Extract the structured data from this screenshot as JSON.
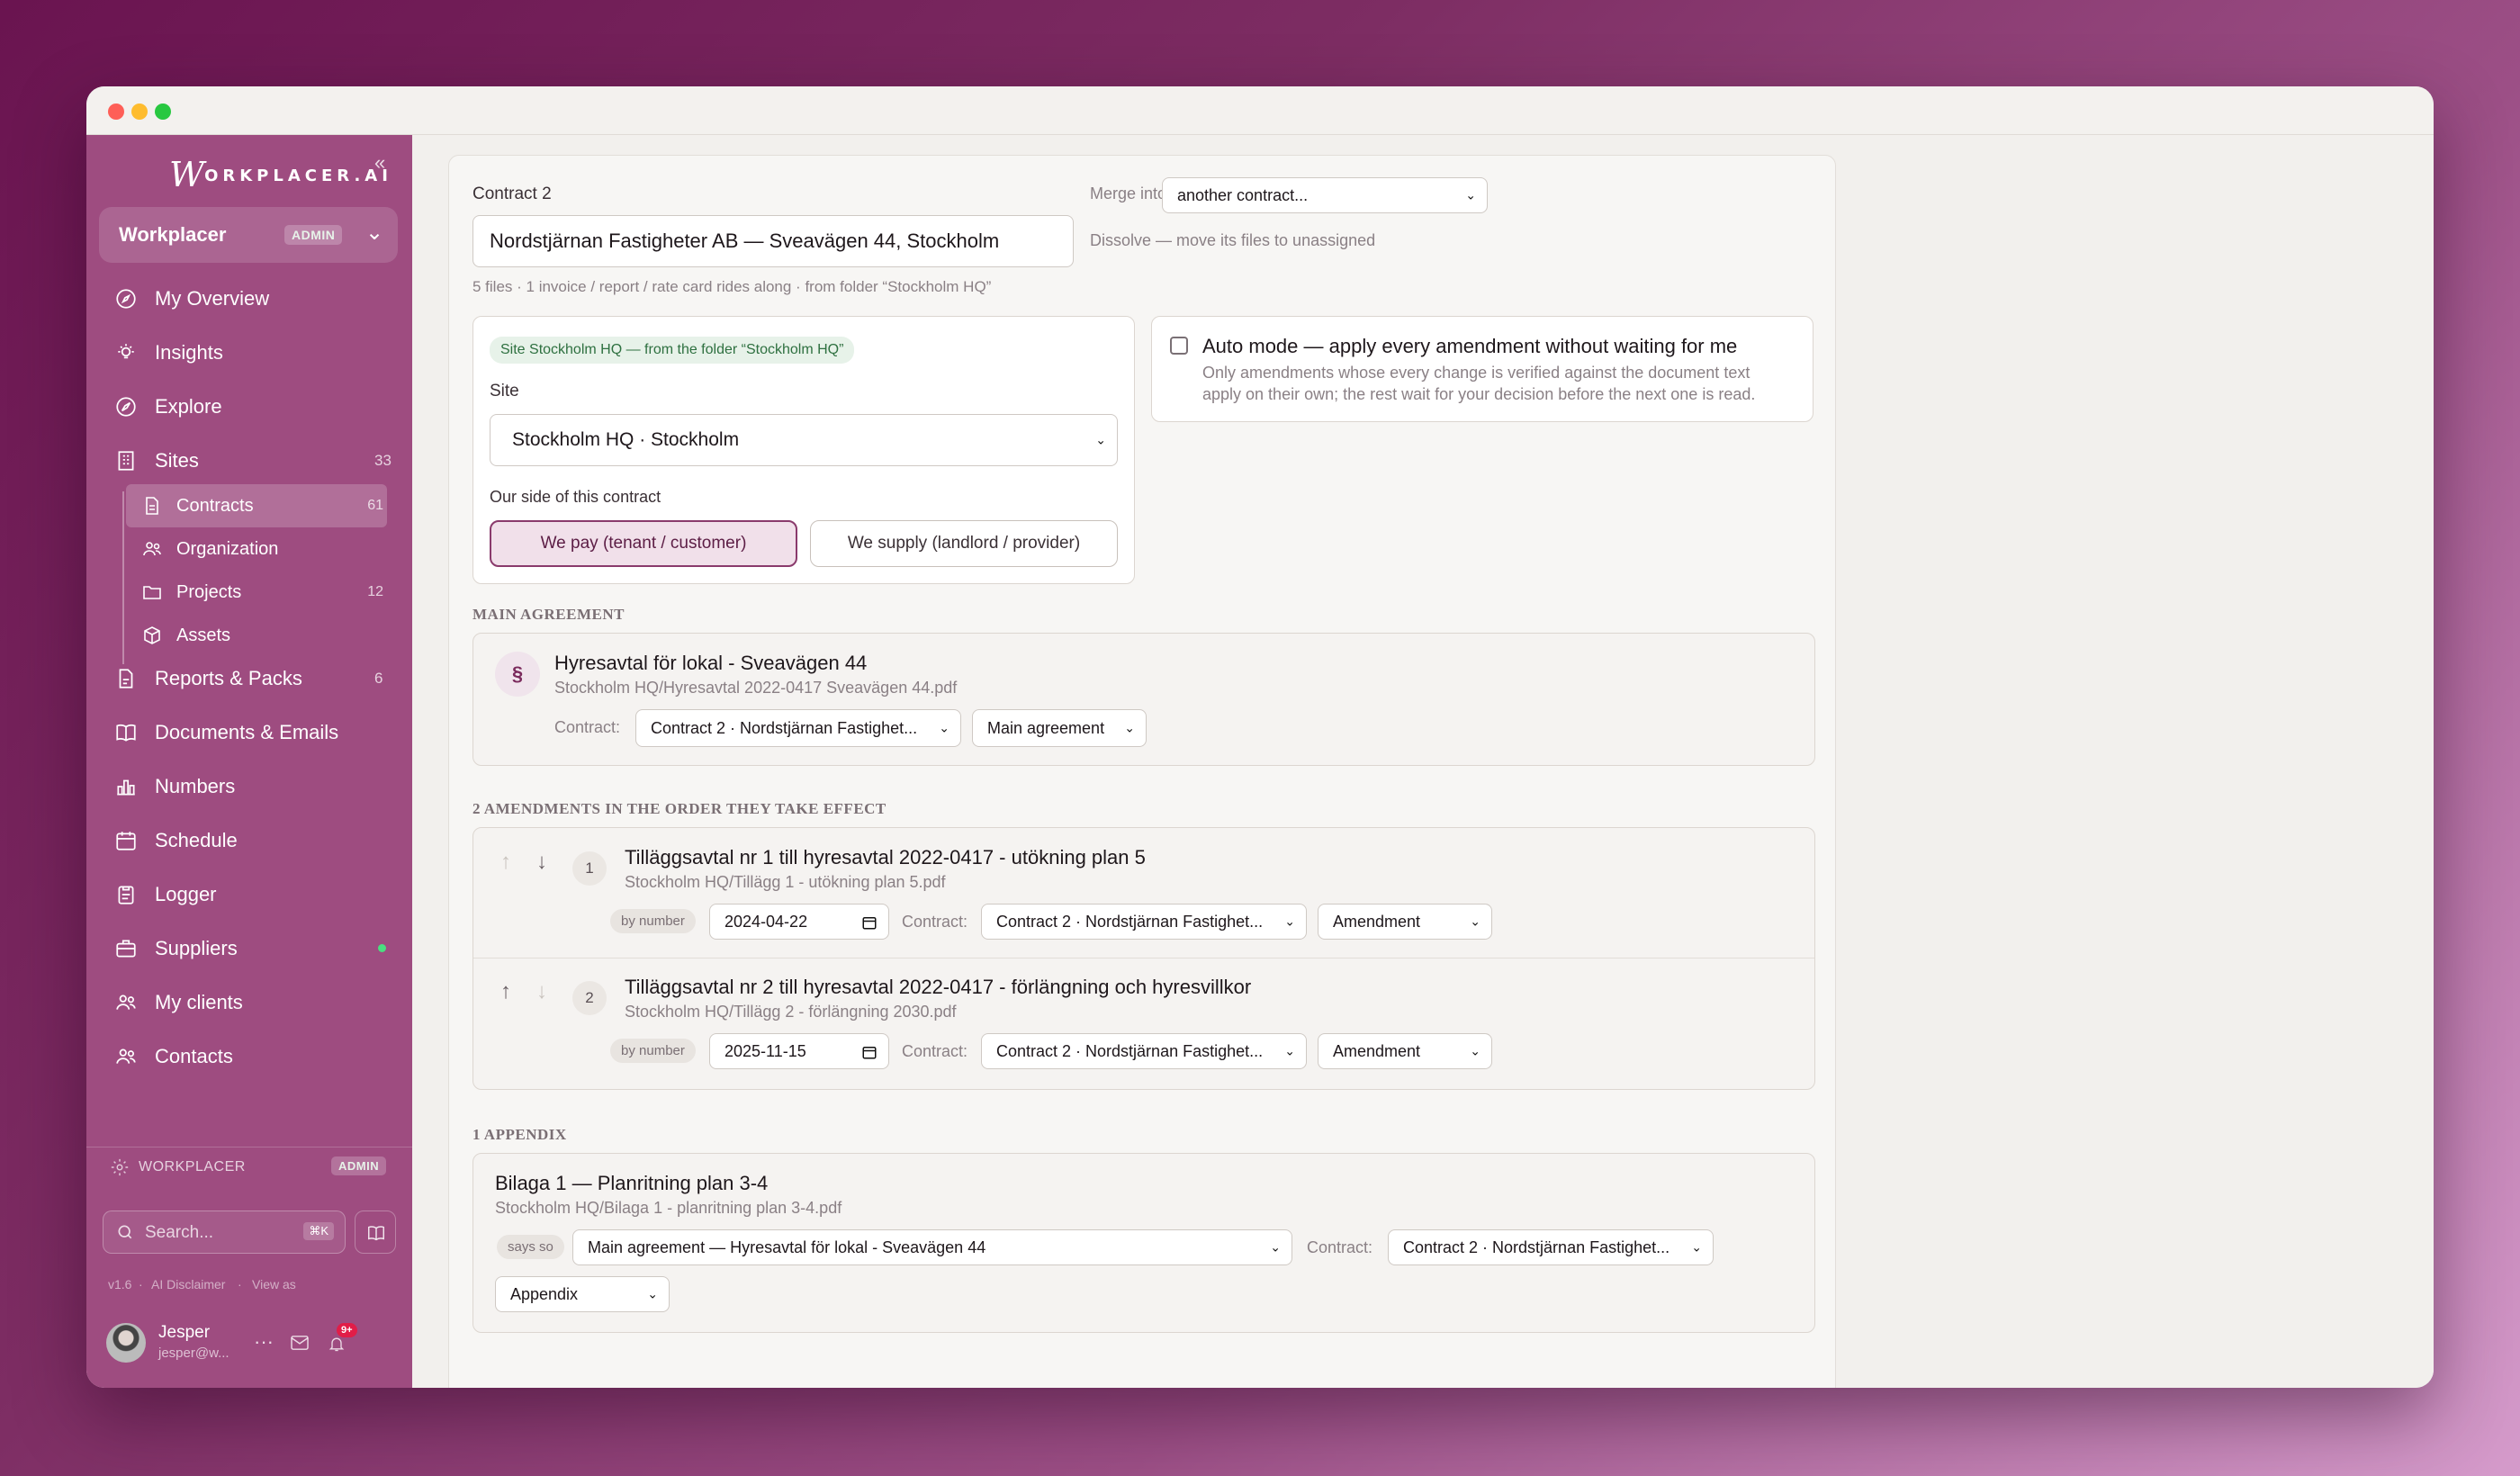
{
  "sidebar": {
    "logo_text": "ORKPLACER.AI",
    "logo_w": "W",
    "workspace": {
      "name": "Workplacer",
      "badge": "ADMIN"
    },
    "nav": [
      {
        "label": "My Overview",
        "icon": "compass-icon"
      },
      {
        "label": "Insights",
        "icon": "lightbulb-icon"
      },
      {
        "label": "Explore",
        "icon": "explore-icon"
      },
      {
        "label": "Sites",
        "icon": "building-icon",
        "count": "33"
      }
    ],
    "subnav": [
      {
        "label": "Contracts",
        "icon": "document-icon",
        "count": "61"
      },
      {
        "label": "Organization",
        "icon": "people-icon"
      },
      {
        "label": "Projects",
        "icon": "folder-icon",
        "count": "12"
      },
      {
        "label": "Assets",
        "icon": "cube-icon"
      }
    ],
    "nav2": [
      {
        "label": "Reports & Packs",
        "icon": "report-icon",
        "count": "6"
      },
      {
        "label": "Documents & Emails",
        "icon": "book-icon"
      },
      {
        "label": "Numbers",
        "icon": "bar-chart-icon"
      },
      {
        "label": "Schedule",
        "icon": "calendar-icon"
      },
      {
        "label": "Logger",
        "icon": "clipboard-icon"
      },
      {
        "label": "Suppliers",
        "icon": "briefcase-icon"
      },
      {
        "label": "My clients",
        "icon": "clients-icon"
      },
      {
        "label": "Contacts",
        "icon": "contacts-icon"
      }
    ],
    "footer": {
      "org": "WORKPLACER",
      "badge": "ADMIN",
      "search_placeholder": "Search...",
      "shortcut": "⌘K",
      "version": "v1.6",
      "disclaimer": "AI Disclaimer",
      "view_as": "View as",
      "user_name": "Jesper",
      "user_email": "jesper@w...",
      "notif_count": "9+"
    }
  },
  "contract": {
    "heading": "Contract 2",
    "name": "Nordstjärnan Fastigheter AB — Sveavägen 44, Stockholm",
    "meta": "5 files · 1 invoice / report / rate card rides along · from folder “Stockholm HQ”",
    "merge_label": "Merge into:",
    "merge_value": "another contract...",
    "dissolve": "Dissolve — move its files to unassigned"
  },
  "site": {
    "pill": "Site Stockholm HQ — from the folder “Stockholm HQ”",
    "label": "Site",
    "value": "Stockholm HQ · Stockholm",
    "side_label": "Our side of this contract",
    "opt_pay": "We pay (tenant / customer)",
    "opt_supply": "We supply (landlord / provider)"
  },
  "auto_mode": {
    "title": "Auto mode — apply every amendment without waiting for me",
    "desc1": "Only amendments whose every change is verified against the document text",
    "desc2": "apply on their own; the rest wait for your decision before the next one is read."
  },
  "main_agreement": {
    "section": "MAIN AGREEMENT",
    "icon": "§",
    "title": "Hyresavtal för lokal - Sveavägen 44",
    "path": "Stockholm HQ/Hyresavtal 2022-0417 Sveavägen 44.pdf",
    "contract_label": "Contract:",
    "contract_value": "Contract 2 · Nordstjärnan Fastighet...",
    "type_value": "Main agreement"
  },
  "amendments": {
    "section": "2 AMENDMENTS IN THE ORDER THEY TAKE EFFECT",
    "items": [
      {
        "num": "1",
        "title": "Tilläggsavtal nr 1 till hyresavtal 2022-0417 - utökning plan 5",
        "path": "Stockholm HQ/Tillägg 1 - utökning plan 5.pdf",
        "chip": "by number",
        "date": "2024-04-22",
        "contract_label": "Contract:",
        "contract_value": "Contract 2 · Nordstjärnan Fastighet...",
        "type_value": "Amendment"
      },
      {
        "num": "2",
        "title": "Tilläggsavtal nr 2 till hyresavtal 2022-0417 - förlängning och hyresvillkor",
        "path": "Stockholm HQ/Tillägg 2 - förlängning 2030.pdf",
        "chip": "by number",
        "date": "2025-11-15",
        "contract_label": "Contract:",
        "contract_value": "Contract 2 · Nordstjärnan Fastighet...",
        "type_value": "Amendment"
      }
    ]
  },
  "appendix": {
    "section": "1 APPENDIX",
    "title": "Bilaga 1 — Planritning plan 3-4",
    "path": "Stockholm HQ/Bilaga 1 - planritning plan 3-4.pdf",
    "chip": "says so",
    "parent_value": "Main agreement — Hyresavtal för lokal - Sveavägen 44",
    "contract_label": "Contract:",
    "contract_value": "Contract 2 · Nordstjärnan Fastighet...",
    "type_value": "Appendix"
  }
}
